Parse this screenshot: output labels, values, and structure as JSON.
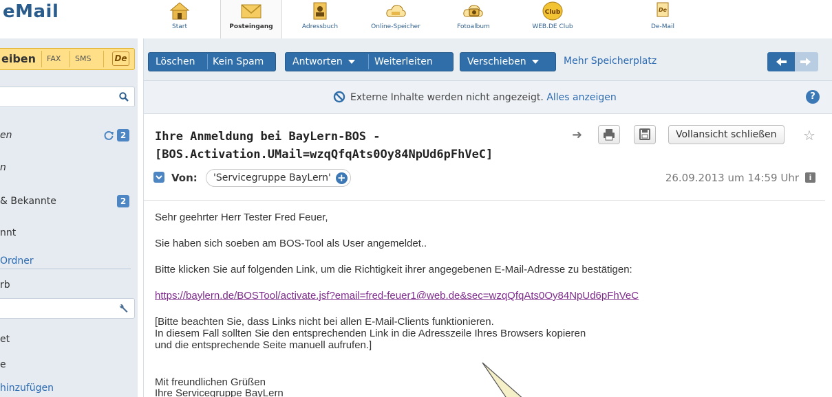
{
  "brand": "eMail",
  "top_nav": [
    {
      "label": "Start",
      "icon": "home-icon"
    },
    {
      "label": "Posteingang",
      "icon": "envelope-icon",
      "active": true
    },
    {
      "label": "Adressbuch",
      "icon": "address-book-icon"
    },
    {
      "label": "Online-Speicher",
      "icon": "cloud-icon"
    },
    {
      "label": "Fotoalbum",
      "icon": "camera-icon"
    },
    {
      "label": "WEB.DE Club",
      "icon": "club-icon"
    },
    {
      "label": "De-Mail",
      "icon": "de-mail-icon"
    }
  ],
  "sidebar": {
    "compose_label": "eiben",
    "compose_options": [
      "FAX",
      "SMS"
    ],
    "de_badge": "De",
    "folders": [
      {
        "label": "en",
        "badge": "2"
      },
      {
        "label": "n"
      },
      {
        "label": " & Bekannte",
        "badge": "2"
      },
      {
        "label": "nnt"
      },
      {
        "label": "Ordner"
      },
      {
        "label": "rb"
      },
      {
        "label": "et"
      },
      {
        "label": "e"
      },
      {
        "label": "hinzufügen"
      }
    ]
  },
  "toolbar": {
    "delete": "Löschen",
    "spam": "Kein Spam",
    "reply": "Antworten",
    "forward": "Weiterleiten",
    "move": "Verschieben",
    "more_storage": "Mehr Speicherplatz"
  },
  "notice": {
    "text": "Externe Inhalte werden nicht angezeigt.",
    "link": "Alles anzeigen",
    "help": "?"
  },
  "mail": {
    "subject_line1": "Ihre Anmeldung bei BayLern-BOS -",
    "subject_line2": "[BOS.Activation.UMail=wzqQfqAts0Oy84NpUd6pFhVeC]",
    "close_full_view": "Vollansicht schließen",
    "from_label": "Von:",
    "sender": "'Servicegruppe BayLern'",
    "date": "26.09.2013 um 14:59 Uhr",
    "body": {
      "greeting": "Sehr geehrter Herr Tester Fred Feuer,",
      "line1": "Sie haben sich soeben am BOS-Tool als User angemeldet..",
      "line2": "Bitte klicken Sie auf folgenden Link, um die Richtigkeit ihrer angegebenen E-Mail-Adresse zu bestätigen:",
      "link": "https://baylern.de/BOSTool/activate.jsf?email=fred-feuer1@web.de&sec=wzqQfqAts0Oy84NpUd6pFhVeC",
      "note1": "[Bitte beachten Sie, dass Links nicht bei allen E-Mail-Clients funktionieren.",
      "note2": "In diesem Fall sollten Sie den entsprechenden Link in die Adresszeile Ihres Browsers kopieren",
      "note3": "und die entsprechende Seite manuell aufrufen.]",
      "closing": "Mit freundlichen Grüßen",
      "signature": "Ihre Servicegruppe BayLern"
    }
  },
  "colors": {
    "accent": "#2f6ea8",
    "compose": "#ffe089",
    "link_visited": "#7e2c8c",
    "sidebar_bg": "#e5ebf1"
  }
}
